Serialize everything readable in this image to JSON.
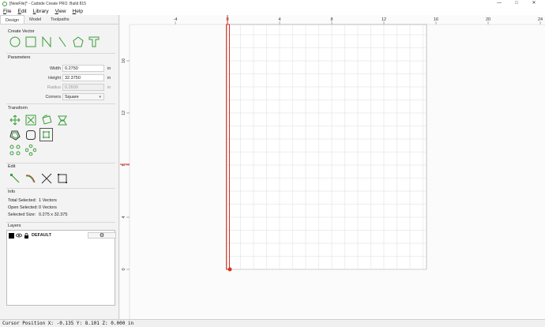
{
  "window": {
    "title": "[NewFile]* - Carbide Create PRO. Build 815",
    "controls": [
      "—",
      "□",
      "✕"
    ]
  },
  "menu": [
    "File",
    "Edit",
    "Library",
    "View",
    "Help"
  ],
  "tabs": [
    "Design",
    "Model",
    "Toolpaths"
  ],
  "create_vector": {
    "title": "Create Vector",
    "tools": [
      "circle-icon",
      "rectangle-icon",
      "curve-icon",
      "polygon-icon",
      "polygon-pentagon-icon",
      "text-icon"
    ]
  },
  "parameters": {
    "title": "Parameters",
    "width_label": "Width",
    "width_value": "0.2750",
    "width_unit": "in",
    "height_label": "Height",
    "height_value": "32.3750",
    "height_unit": "in",
    "radius_label": "Radius",
    "radius_value": "0.2600",
    "radius_unit": "in",
    "corners_label": "Corners",
    "corners_value": "Square"
  },
  "transform": {
    "title": "Transform"
  },
  "edit": {
    "title": "Edit"
  },
  "info": {
    "title": "Info",
    "total_selected_label": "Total Selected:",
    "total_selected_value": "1 Vectors",
    "open_selected_label": "Open Selected:",
    "open_selected_value": "0 Vectors",
    "selected_size_label": "Selected Size:",
    "selected_size_value": "0.275 x 32.375"
  },
  "layers": {
    "title": "Layers",
    "items": [
      {
        "name": "DEFAULT",
        "color": "#000000"
      }
    ]
  },
  "ruler": {
    "x_ticks": [
      "-4",
      "0",
      "4",
      "8",
      "12",
      "16",
      "20",
      "24"
    ],
    "y_ticks": [
      "16",
      "12",
      "8",
      "4",
      "0"
    ]
  },
  "status": {
    "cursor": "Cursor Position X: -0.135 Y: 8.101 Z: 0.000 in"
  },
  "colors": {
    "accent": "#3a9d3a",
    "selection": "#e0301e",
    "grid": "#dcdcdc"
  }
}
